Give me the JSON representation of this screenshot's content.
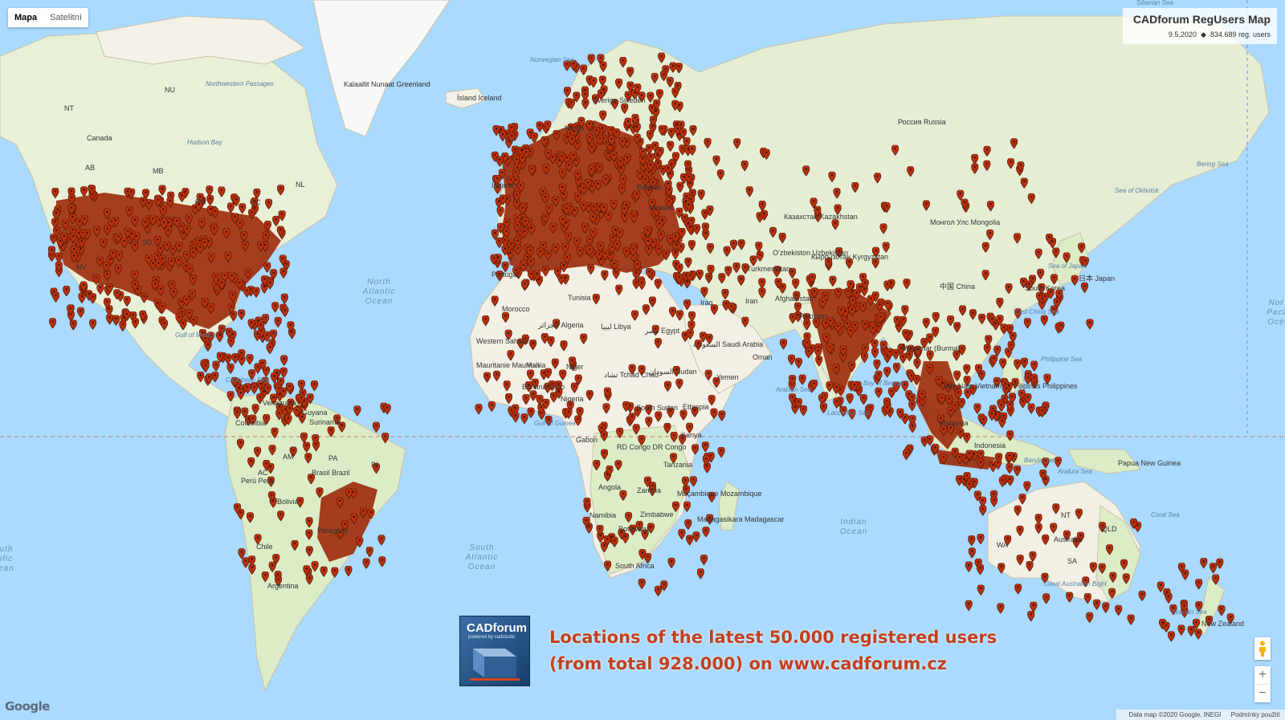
{
  "map_type": {
    "map": "Mapa",
    "satellite": "Satelitní"
  },
  "title": "CADforum RegUsers Map",
  "date": "9.5.2020",
  "users": "834.689 reg. users",
  "caption": {
    "line1": "Locations of the latest 50.000 registered users",
    "line2": "(from total 928.000) on www.cadforum.cz"
  },
  "logo": {
    "brand": "CADforum",
    "sub": "powered by cadstudio"
  },
  "google": "Google",
  "attribution": {
    "data": "Data map ©2020 Google, INEGI",
    "terms": "Podmínky použití"
  },
  "zoom": {
    "in": "+",
    "out": "−"
  },
  "colors": {
    "ocean": "#aadaff",
    "land": "#f2efe4",
    "forest": "#cfe8c0",
    "marker": "#b5300c"
  },
  "labels": {
    "oceans": [
      {
        "id": "north-atlantic",
        "lines": [
          "North",
          "Atlantic",
          "Ocean"
        ]
      },
      {
        "id": "south-atlantic",
        "lines": [
          "South",
          "Atlantic",
          "Ocean"
        ]
      },
      {
        "id": "indian",
        "lines": [
          "Indian",
          "Ocean"
        ]
      },
      {
        "id": "south-pacific",
        "lines": [
          "uth",
          "ific",
          "ean"
        ]
      },
      {
        "id": "north-pacific",
        "lines": [
          "Nor",
          "Paci",
          "Oce"
        ]
      }
    ],
    "seas": [
      "Norwegian Sea",
      "Hudson Bay",
      "Northwestern Passages",
      "Gulf of Mexico",
      "Caribbean Sea",
      "Gulf of Guinea",
      "Arabian Sea",
      "Bay of Bengal",
      "Laccadive Sea",
      "Philippine Sea",
      "East China Sea",
      "Sea of Japan",
      "Sea of Okhotsk",
      "Bering Sea",
      "Banda Sea",
      "Arafura Sea",
      "Coral Sea",
      "Tasman Sea",
      "Great Australian Bight",
      "Siberian Sea"
    ],
    "countries": [
      "Canada",
      "NU",
      "NT",
      "AB",
      "MB",
      "ON",
      "QC",
      "NL",
      "SD",
      "NV",
      "Kalaallit Nunaat Greenland",
      "Ísland Iceland",
      "Sverige Sweden",
      "Norge",
      "Россия Russia",
      "Казахстан Kazakhstan",
      "Монгол Улс Mongolia",
      "中国 China",
      "Belarus",
      "Ukraine",
      "Ireland",
      "Portugal",
      "Morocco",
      "الجزائر Algeria",
      "ليبيا Libya",
      "مصر Egypt",
      "السعودية Saudi Arabia",
      "Iraq",
      "Iran",
      "Afghanistan",
      "Pakistan",
      "Oʻzbekiston Uzbekistan",
      "Turkmenistan",
      "Кыргызстан Kyrgyzstan",
      "Mauritanie Mauritania",
      "Mali",
      "Niger",
      "تشاد Tchad Chad",
      "السودان Sudan",
      "Burkina Faso",
      "Nigeria",
      "South Sudan",
      "Ethiopia",
      "Yemen",
      "Oman",
      "Kenya",
      "RD Congo DR Congo",
      "Gabon",
      "Tanzania",
      "Angola",
      "Zambia",
      "Moçambique Mozambique",
      "Namibia",
      "Zimbabwe",
      "Botswana",
      "South Africa",
      "Madagasikara Madagascar",
      "Western Sahara",
      "Tunisia",
      "Venezuela",
      "Colombia",
      "Guyana",
      "Suriname",
      "Perú Peru",
      "Brasil Brazil",
      "Bolivia",
      "Paraguay",
      "Chile",
      "Argentina",
      "AM",
      "PA",
      "AC",
      "PI",
      "Myanmar (Burma)",
      "Việt Nam Vietnam",
      "Malaysia",
      "Indonesia",
      "Pilipinas Philippines",
      "South Korea",
      "日本 Japan",
      "Papua New Guinea",
      "Australia",
      "WA",
      "NT",
      "QLD",
      "SA",
      "New Zealand"
    ]
  }
}
